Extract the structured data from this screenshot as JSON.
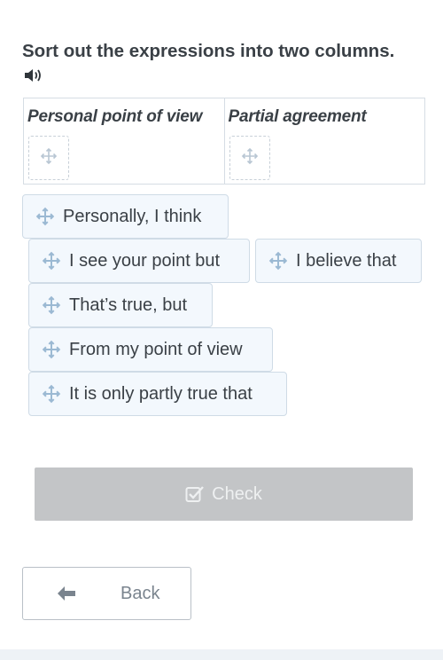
{
  "instruction": "Sort out the expressions into two columns.",
  "columns": [
    {
      "header": "Personal point of view"
    },
    {
      "header": "Partial agreement"
    }
  ],
  "cards": [
    "Personally, I think",
    "I see your point but",
    "I believe that",
    "That’s true, but",
    "From my point of view",
    "It is only partly true that"
  ],
  "buttons": {
    "check_label": "Check",
    "back_label": "Back"
  },
  "icons": {
    "audio": "speaker-icon",
    "move": "move-arrows-icon",
    "check": "checkbox-icon",
    "back": "arrow-left-icon"
  },
  "colors": {
    "card_bg": "#f3f8fd",
    "card_border": "#cfdbe6",
    "check_disabled": "#c3c5c7",
    "icon_blue": "#9bb9d3"
  }
}
